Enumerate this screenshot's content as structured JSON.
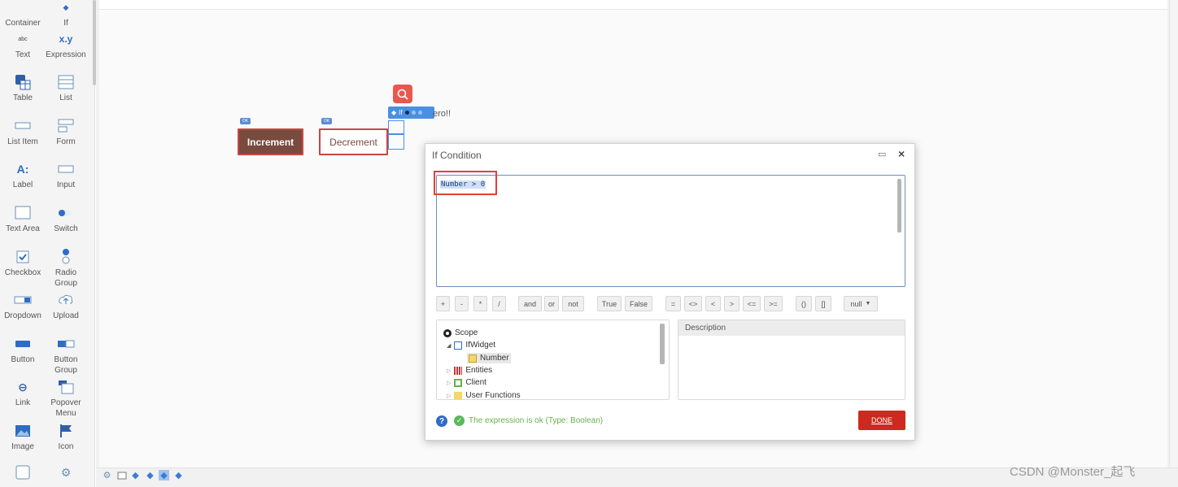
{
  "toolbox": {
    "items": [
      {
        "label": "Container"
      },
      {
        "label": "If"
      },
      {
        "label": "Text"
      },
      {
        "label": "Expression"
      },
      {
        "label": "Table"
      },
      {
        "label": "List"
      },
      {
        "label": "List Item"
      },
      {
        "label": "Form"
      },
      {
        "label": "Label"
      },
      {
        "label": "Input"
      },
      {
        "label": "Text Area"
      },
      {
        "label": "Switch"
      },
      {
        "label": "Checkbox"
      },
      {
        "label": "Radio Group"
      },
      {
        "label": "Dropdown"
      },
      {
        "label": "Upload"
      },
      {
        "label": "Button"
      },
      {
        "label": "Button Group"
      },
      {
        "label": "Link"
      },
      {
        "label": "Popover Menu"
      },
      {
        "label": "Image"
      },
      {
        "label": "Icon"
      }
    ],
    "text_glyph": "abc",
    "expression_glyph": "x.y",
    "label_glyph": "A:"
  },
  "canvas": {
    "increment_label": "Increment",
    "decrement_label": "Decrement",
    "ok_badge": "OK",
    "if_widget_label": "If",
    "if_text_fragment": "ero!!"
  },
  "dialog": {
    "title": "If Condition",
    "expression": "Number > 0",
    "operators": [
      "+",
      "-",
      "*",
      "/",
      "and",
      "or",
      "not",
      "True",
      "False",
      "=",
      "<>",
      "<",
      ">",
      "<=",
      ">=",
      "()",
      "[]",
      "null"
    ],
    "tree": {
      "scope": "Scope",
      "ifwidget": "IfWidget",
      "number": "Number",
      "entities": "Entities",
      "client": "Client",
      "user_functions": "User Functions"
    },
    "description_header": "Description",
    "status": "The expression is ok (Type: Boolean)",
    "done_label": "DONE"
  },
  "watermark": "CSDN @Monster_起飞",
  "colors": {
    "accent": "#4a90e2",
    "done": "#cc2a1e",
    "ok_green": "#5cb85c",
    "increment_bg": "#7a4a3e",
    "highlight_red": "#e0403a"
  }
}
